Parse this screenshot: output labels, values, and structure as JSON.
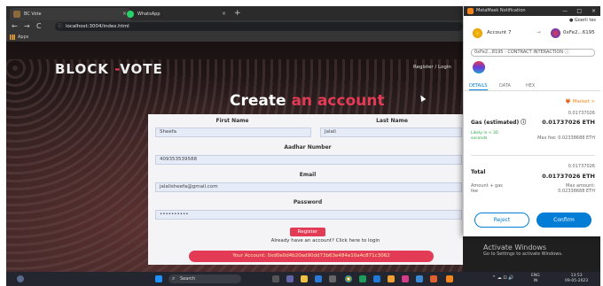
{
  "browser": {
    "tabs": [
      {
        "label": "BC Vote",
        "active": true
      },
      {
        "label": "WhatsApp",
        "active": false
      }
    ],
    "new_tab": "+",
    "close": "×",
    "back": "←",
    "forward": "→",
    "reload": "C",
    "info": "ⓘ",
    "url": "localhost:3004/index.html",
    "bookmark": "Apps"
  },
  "site": {
    "logo_part1": "BLOCK",
    "logo_dash": " -",
    "logo_part2": "VOTE",
    "nav": "Register / Login",
    "heading_part1": "Create ",
    "heading_part2": "an account"
  },
  "form": {
    "first_name_label": "First Name",
    "last_name_label": "Last Name",
    "first_name_value": "Sheefa",
    "last_name_value": "Jalali",
    "aadhar_label": "Aadhar Number",
    "aadhar_value": "409353539588",
    "email_label": "Email",
    "email_value": "jalalisheefa@gmail.com",
    "password_label": "Password",
    "password_value": "••••••••••",
    "register_button": "Register",
    "login_prompt": "Already have an account? Click here to login",
    "account_text": "Your Account: 0xd0e0d4b20ad90dd73b63e484e10a4c871c3062"
  },
  "metamask": {
    "window_title": "MetaMask Notification",
    "minimize": "—",
    "maximize": "□",
    "close": "×",
    "network": "● Goerli tes",
    "from_account": "Account 7",
    "arrow": "→",
    "to_account": "0xFe2...6195",
    "contract": "0xFe2...8195 : CONTRACT INTERACTION ⓘ",
    "tabs": [
      "DETAILS",
      "DATA",
      "HEX"
    ],
    "market": "🦊 Market >",
    "gas_top": "0.01737026",
    "gas_label": "Gas (estimated) ⓘ",
    "gas_value": "0.01737026 ETH",
    "likely": "Likely in < 30 seconds",
    "max_fee": "Max fee: 0.02338688 ETH",
    "total_top": "0.01737026",
    "total_label": "Total",
    "total_value": "0.01737026 ETH",
    "amount_gas": "Amount + gas fee",
    "max_amount": "Max amount: 0.02338688 ETH",
    "reject": "Reject",
    "confirm": "Confirm"
  },
  "windows": {
    "activate_title": "Activate Windows",
    "activate_sub": "Go to Settings to activate Windows.",
    "search": "Search",
    "search_icon": "⌕",
    "lang": "ENG",
    "region": "IN",
    "time": "13:53",
    "date": "09-05-2023",
    "tray_icons": "^ ☁ ⊡ 🔊"
  }
}
